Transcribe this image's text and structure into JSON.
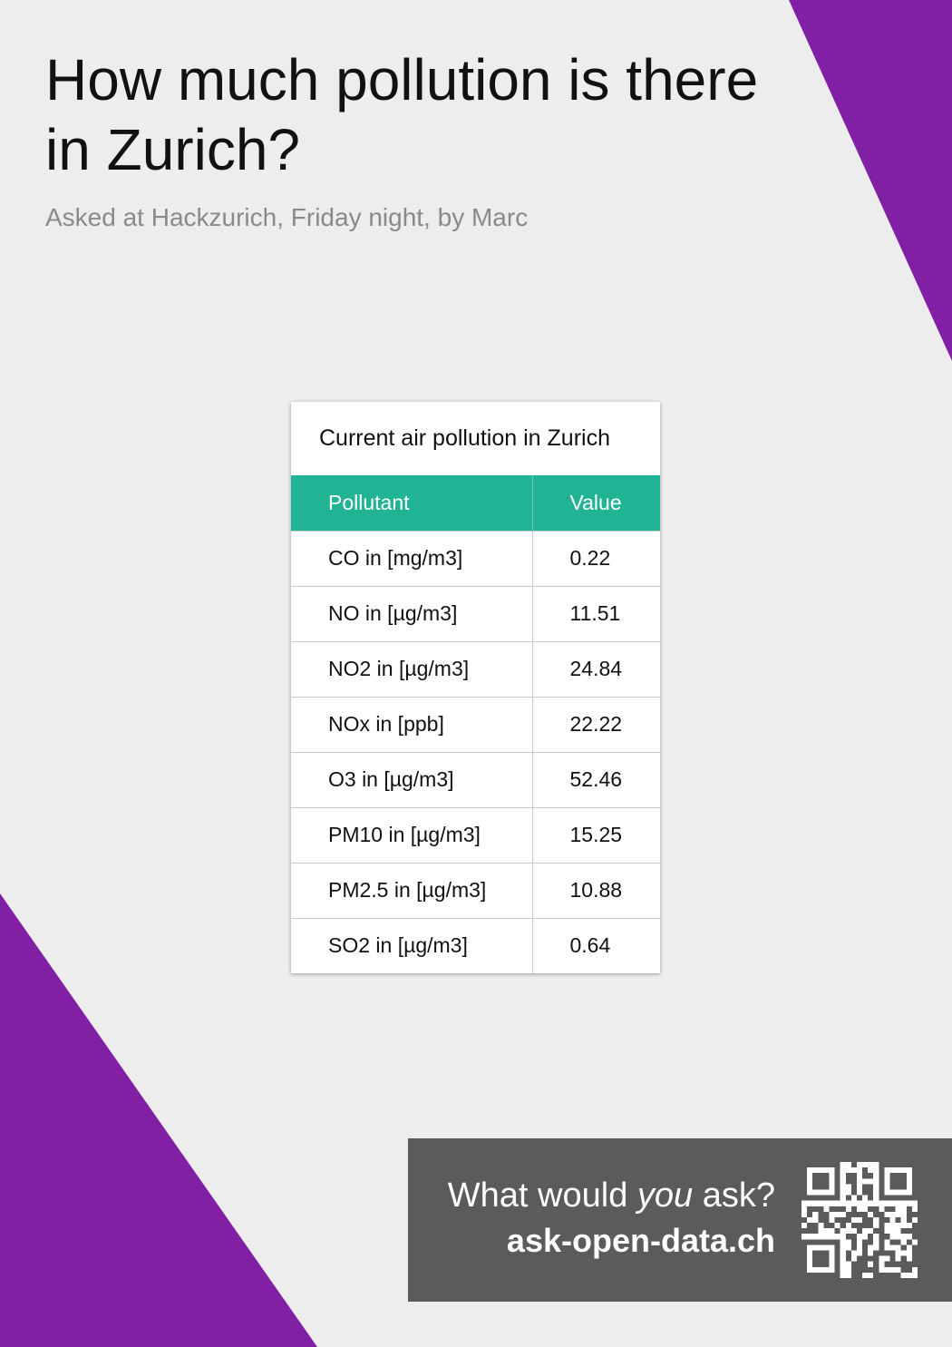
{
  "header": {
    "title": "How much pollution is there in Zurich?",
    "subtitle": "Asked at Hackzurich, Friday night, by Marc"
  },
  "card": {
    "title": "Current air pollution in Zurich",
    "columns": [
      "Pollutant",
      "Value"
    ],
    "rows": [
      {
        "pollutant": "CO in [mg/m3]",
        "value": "0.22"
      },
      {
        "pollutant": "NO in [µg/m3]",
        "value": "11.51"
      },
      {
        "pollutant": "NO2 in [µg/m3]",
        "value": "24.84"
      },
      {
        "pollutant": "NOx in [ppb]",
        "value": "22.22"
      },
      {
        "pollutant": "O3 in [µg/m3]",
        "value": "52.46"
      },
      {
        "pollutant": "PM10 in [µg/m3]",
        "value": "15.25"
      },
      {
        "pollutant": "PM2.5 in [µg/m3]",
        "value": "10.88"
      },
      {
        "pollutant": "SO2 in [µg/m3]",
        "value": "0.64"
      }
    ]
  },
  "cta": {
    "question_before": "What would ",
    "question_emphasis": "you",
    "question_after": " ask?",
    "url": "ask-open-data.ch",
    "qr_icon": "qr-code-icon"
  },
  "colors": {
    "accent_purple": "#8120a4",
    "table_header_green": "#20b394",
    "background": "#ededed",
    "cta_background": "#5b5b5d"
  }
}
